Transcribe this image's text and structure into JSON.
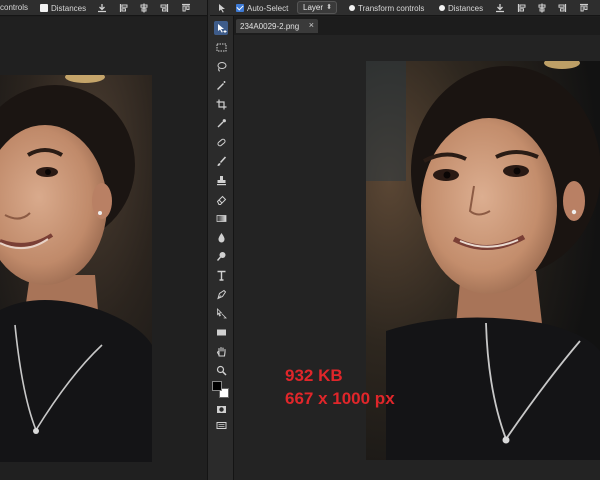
{
  "left_options": {
    "transform_partial": "controls",
    "distances_label": "Distances"
  },
  "right_options": {
    "auto_select_label": "Auto-Select",
    "layer_select_value": "Layer",
    "transform_controls_label": "Transform controls",
    "distances_label": "Distances"
  },
  "document": {
    "tab_title": "234A0029-2.png",
    "close_glyph": "×"
  },
  "overlay": {
    "file_size": "932 KB",
    "dimensions": "667 x 1000 px"
  },
  "colors": {
    "annotation_red": "#e0262a",
    "checkbox_blue": "#3e7bd6"
  }
}
